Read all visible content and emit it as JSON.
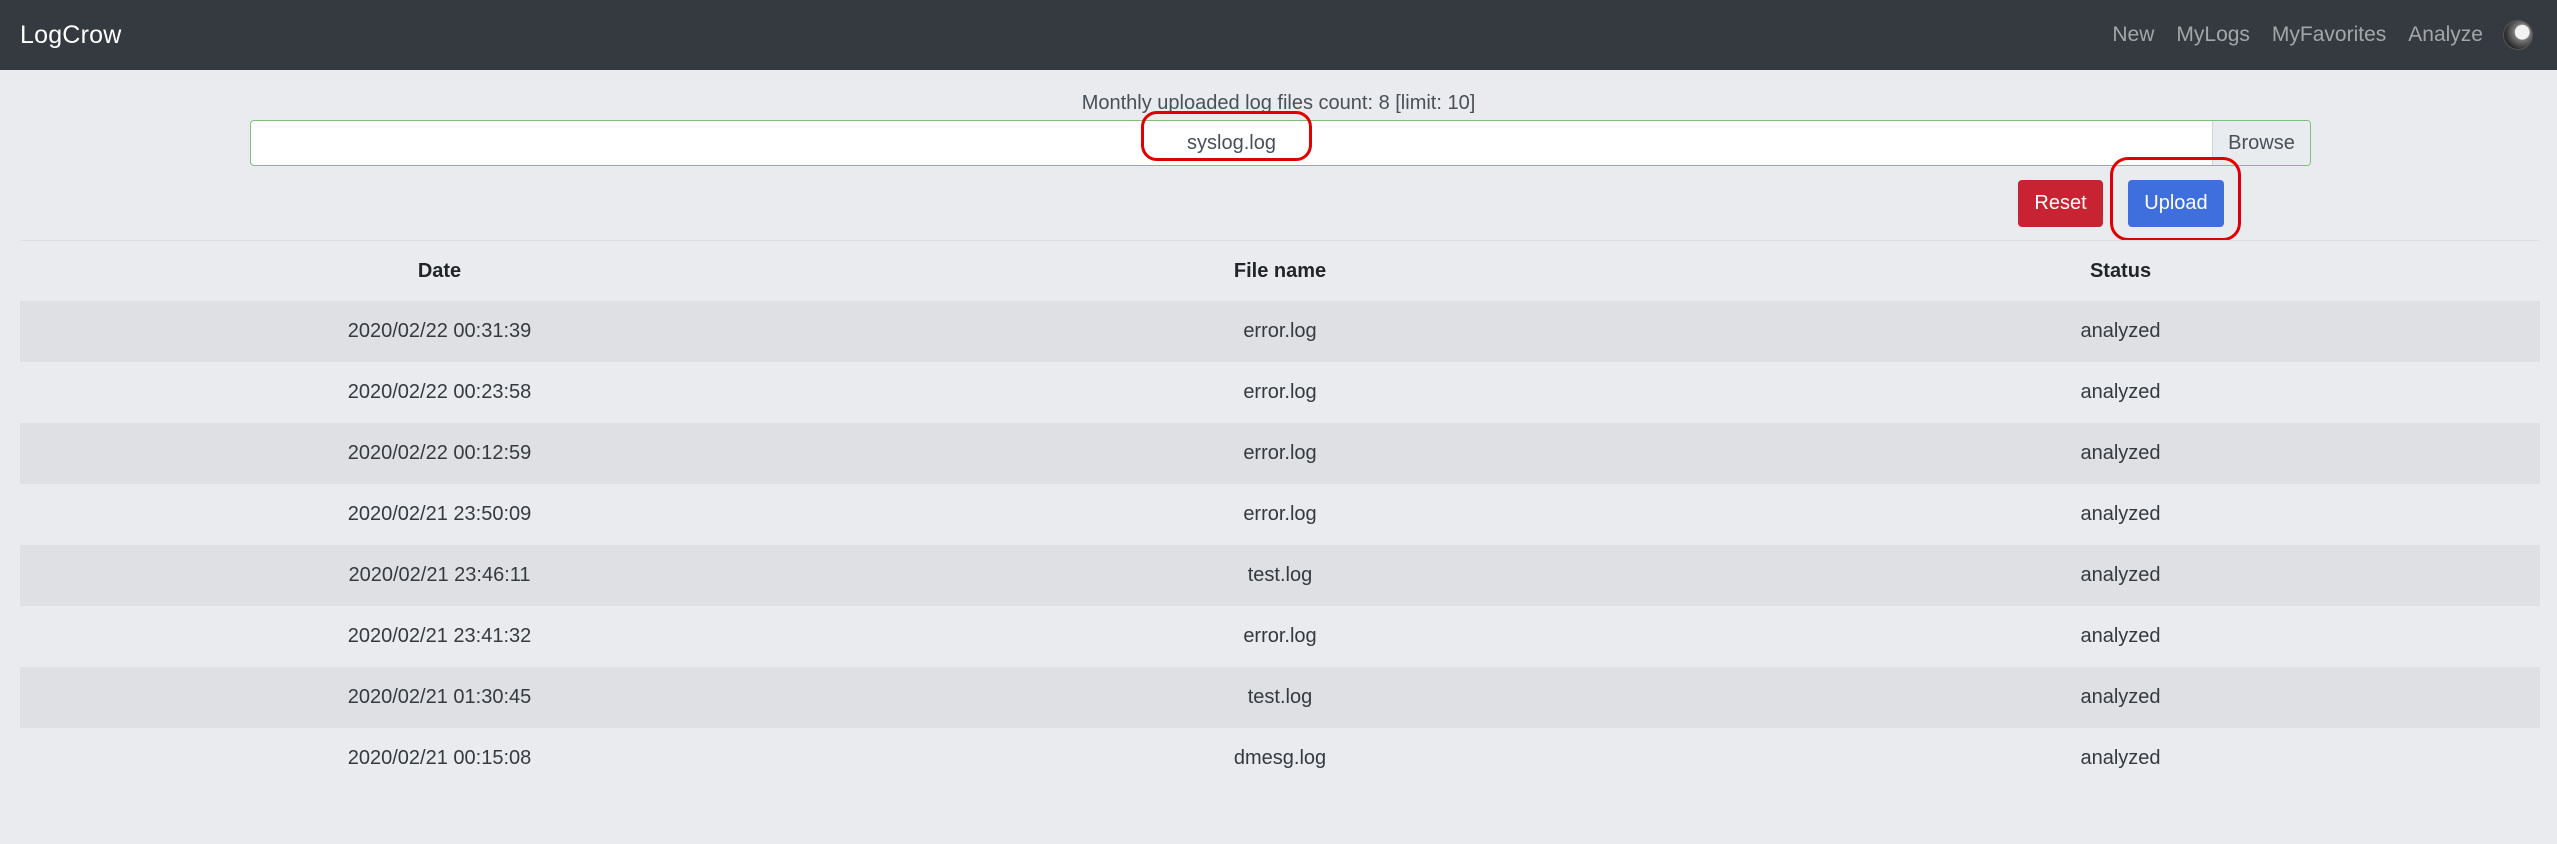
{
  "navbar": {
    "brand": "LogCrow",
    "links": [
      "New",
      "MyLogs",
      "MyFavorites",
      "Analyze"
    ]
  },
  "upload": {
    "count_text": "Monthly uploaded log files count: 8 [limit: 10]",
    "file_name": "syslog.log",
    "browse_label": "Browse",
    "reset_label": "Reset",
    "upload_label": "Upload"
  },
  "table": {
    "headers": [
      "Date",
      "File name",
      "Status"
    ],
    "rows": [
      [
        "2020/02/22 00:31:39",
        "error.log",
        "analyzed"
      ],
      [
        "2020/02/22 00:23:58",
        "error.log",
        "analyzed"
      ],
      [
        "2020/02/22 00:12:59",
        "error.log",
        "analyzed"
      ],
      [
        "2020/02/21 23:50:09",
        "error.log",
        "analyzed"
      ],
      [
        "2020/02/21 23:46:11",
        "test.log",
        "analyzed"
      ],
      [
        "2020/02/21 23:41:32",
        "error.log",
        "analyzed"
      ],
      [
        "2020/02/21 01:30:45",
        "test.log",
        "analyzed"
      ],
      [
        "2020/02/21 00:15:08",
        "dmesg.log",
        "analyzed"
      ]
    ]
  },
  "colors": {
    "navbar_bg": "#343a40",
    "reset_bg": "#c82333",
    "upload_bg": "#3e6fdc",
    "annotation": "#e00000"
  }
}
